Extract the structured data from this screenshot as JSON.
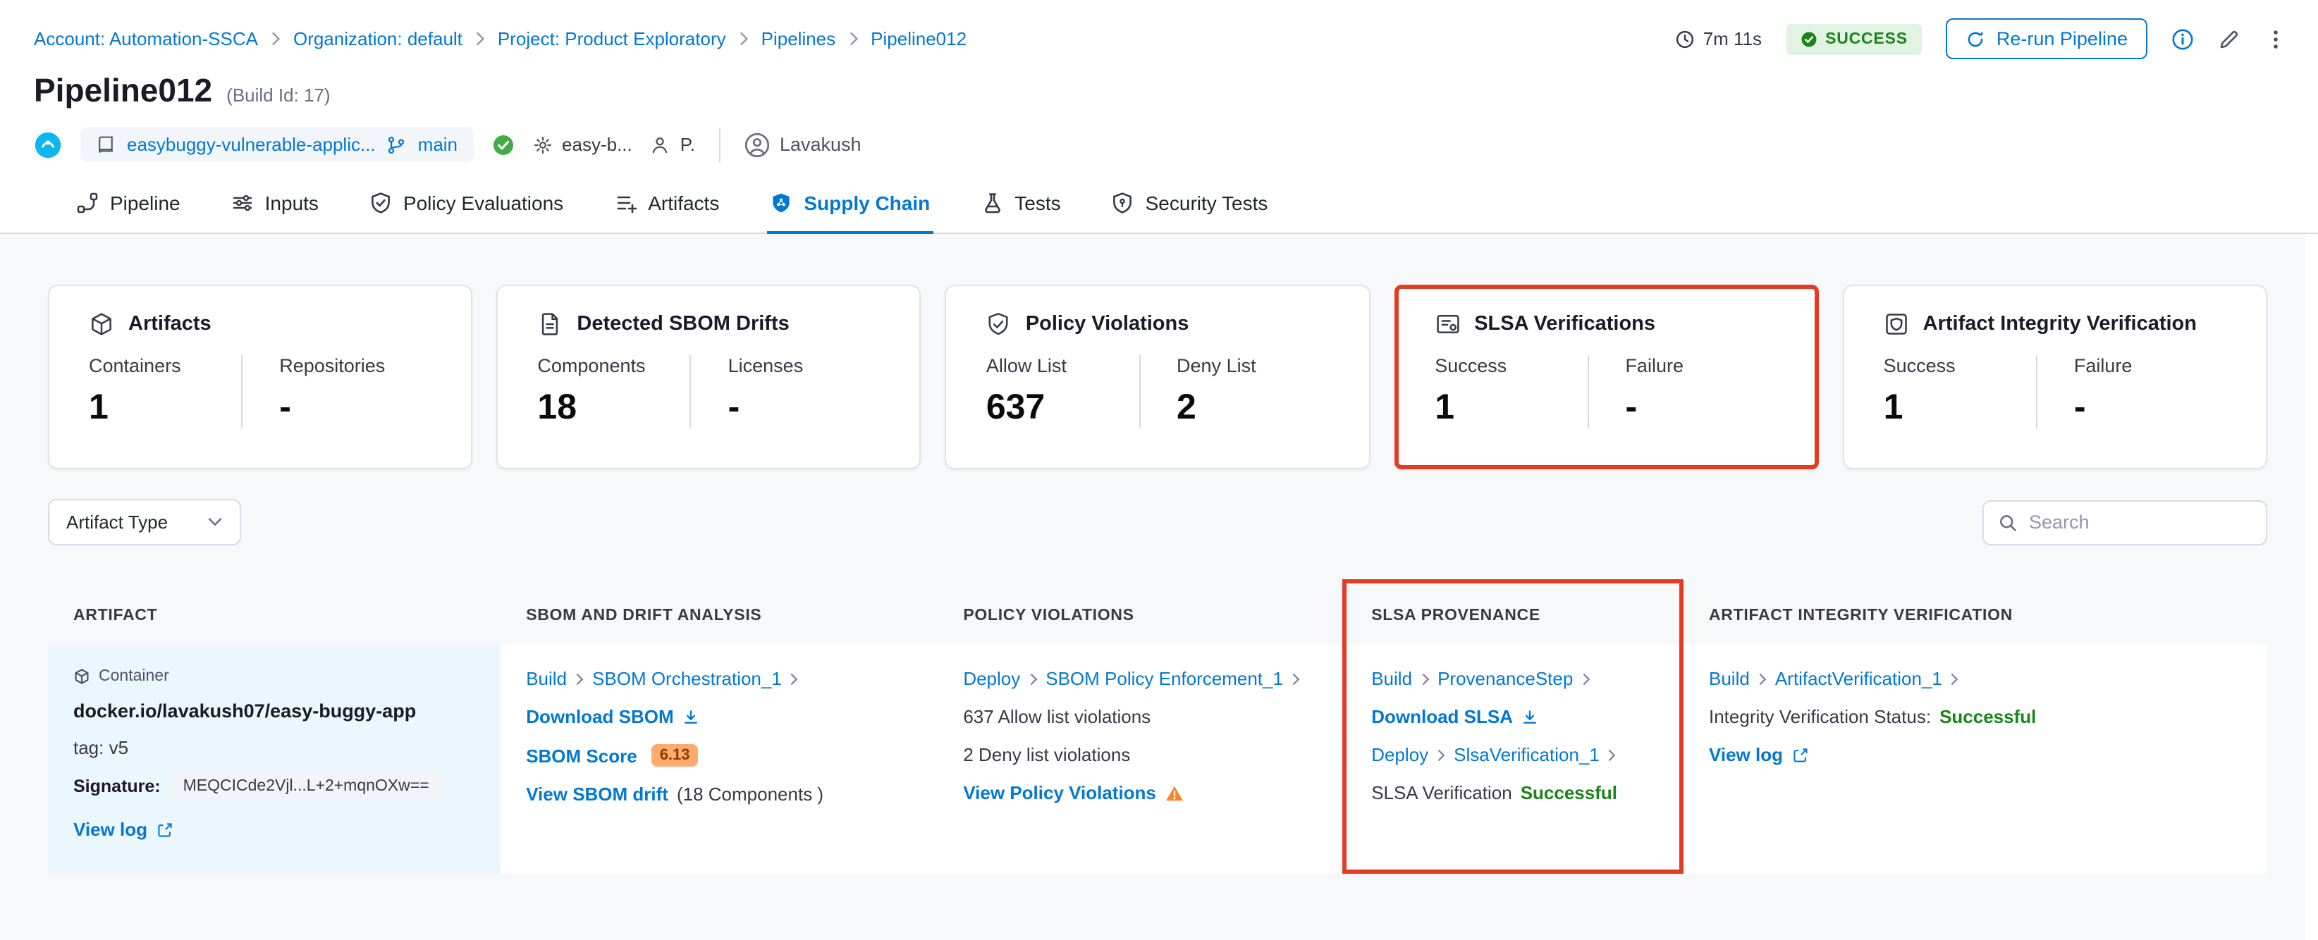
{
  "colors": {
    "accent_blue": "#0278d5",
    "success_green": "#1b841b",
    "highlight_red": "#e23c24",
    "warning_orange": "#ff832b",
    "score_badge_bg": "#ffab70",
    "artifact_cell_bg": "#ecf6fd"
  },
  "breadcrumb": {
    "items": [
      "Account: Automation-SSCA",
      "Organization: default",
      "Project: Product Exploratory",
      "Pipelines",
      "Pipeline012"
    ]
  },
  "topbar": {
    "duration": "7m 11s",
    "status": "SUCCESS",
    "rerun": "Re-run Pipeline"
  },
  "header": {
    "title": "Pipeline012",
    "build": "(Build Id: 17)",
    "repo": "easybuggy-vulnerable-applic...",
    "branch": "main",
    "service": "easy-b...",
    "secondary": "P.",
    "user": "Lavakush"
  },
  "tabs": [
    {
      "label": "Pipeline"
    },
    {
      "label": "Inputs"
    },
    {
      "label": "Policy Evaluations"
    },
    {
      "label": "Artifacts"
    },
    {
      "label": "Supply Chain"
    },
    {
      "label": "Tests"
    },
    {
      "label": "Security Tests"
    }
  ],
  "cards": [
    {
      "title": "Artifacts",
      "stats": [
        {
          "label": "Containers",
          "value": "1"
        },
        {
          "label": "Repositories",
          "value": "-"
        }
      ]
    },
    {
      "title": "Detected SBOM Drifts",
      "stats": [
        {
          "label": "Components",
          "value": "18"
        },
        {
          "label": "Licenses",
          "value": "-"
        }
      ]
    },
    {
      "title": "Policy Violations",
      "stats": [
        {
          "label": "Allow List",
          "value": "637"
        },
        {
          "label": "Deny List",
          "value": "2"
        }
      ]
    },
    {
      "title": "SLSA Verifications",
      "stats": [
        {
          "label": "Success",
          "value": "1"
        },
        {
          "label": "Failure",
          "value": "-"
        }
      ]
    },
    {
      "title": "Artifact Integrity Verification",
      "stats": [
        {
          "label": "Success",
          "value": "1"
        },
        {
          "label": "Failure",
          "value": "-"
        }
      ]
    }
  ],
  "filters": {
    "artifact_type": "Artifact Type",
    "search_placeholder": "Search"
  },
  "table": {
    "headers": [
      "ARTIFACT",
      "SBOM AND DRIFT ANALYSIS",
      "POLICY VIOLATIONS",
      "SLSA PROVENANCE",
      "ARTIFACT INTEGRITY VERIFICATION"
    ],
    "row": {
      "artifact": {
        "type_chip": "Container",
        "name": "docker.io/lavakush07/easy-buggy-app",
        "tag": "tag: v5",
        "signature_label": "Signature:",
        "signature": "MEQCICde2Vjl...L+2+mqnOXw==",
        "view_log": "View log"
      },
      "sbom": {
        "stage": "Build",
        "step": "SBOM Orchestration_1",
        "download": "Download SBOM",
        "score_label": "SBOM Score",
        "score": "6.13",
        "drift_link": "View SBOM drift",
        "drift_components": "(18 Components )"
      },
      "policy": {
        "stage": "Deploy",
        "step": "SBOM Policy Enforcement_1",
        "allow": "637 Allow list violations",
        "deny": "2 Deny list violations",
        "view": "View Policy Violations"
      },
      "slsa": {
        "stage1": "Build",
        "step1": "ProvenanceStep",
        "download": "Download SLSA",
        "stage2": "Deploy",
        "step2": "SlsaVerification_1",
        "verification_label": "SLSA Verification",
        "verification_status": "Successful"
      },
      "integrity": {
        "stage": "Build",
        "step": "ArtifactVerification_1",
        "status_label": "Integrity Verification Status:",
        "status": "Successful",
        "view_log": "View log"
      }
    }
  }
}
